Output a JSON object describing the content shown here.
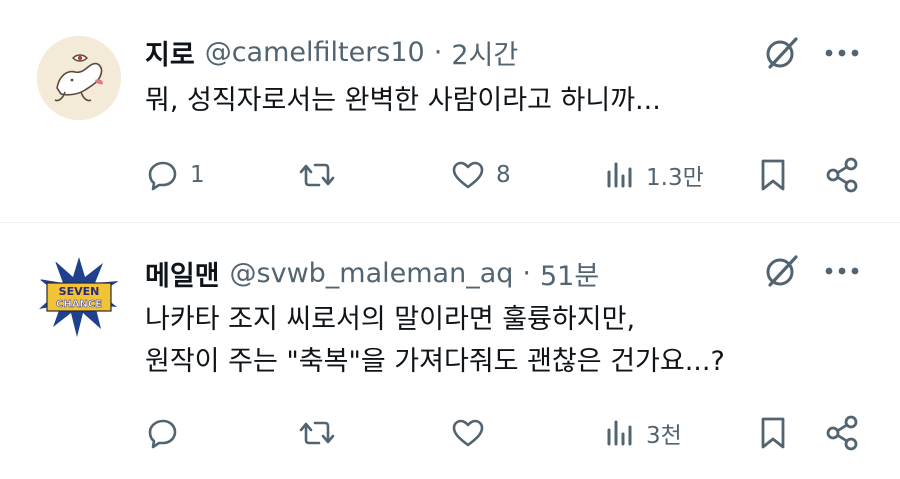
{
  "tweets": [
    {
      "name": "지로",
      "handle": "@camelfilters10",
      "separator": "·",
      "time": "2시간",
      "text_lines": [
        "뭐, 성직자로서는 완벽한 사람이라고 하니까..."
      ],
      "metrics": {
        "replies": "1",
        "retweets": "",
        "likes": "8",
        "views": "1.3만"
      }
    },
    {
      "name": "메일맨",
      "handle": "@svwb_maleman_aq",
      "separator": "·",
      "time": "51분",
      "text_lines": [
        "나카타 조지 씨로서의 말이라면 훌륭하지만,",
        "원작이 주는 \"축복\"을 가져다줘도 괜찮은 건가요...?"
      ],
      "avatar_text": [
        "SEVEN",
        "CHANCE"
      ],
      "metrics": {
        "replies": "",
        "retweets": "",
        "likes": "",
        "views": "3천"
      }
    }
  ],
  "icons": {
    "header": [
      "grok-icon",
      "more-icon"
    ],
    "actions": [
      "reply-icon",
      "retweet-icon",
      "like-icon",
      "views-icon",
      "bookmark-icon",
      "share-icon"
    ]
  },
  "colors": {
    "text": "#0f1419",
    "secondary": "#536471",
    "divider": "#eff3f4"
  }
}
